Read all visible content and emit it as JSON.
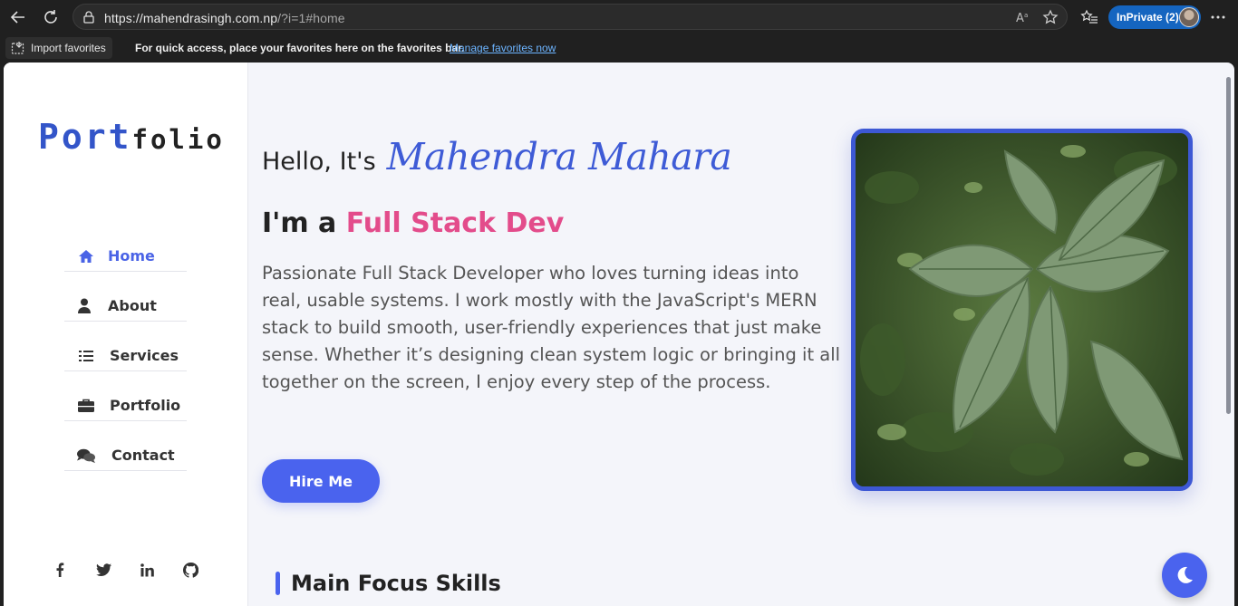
{
  "browser": {
    "url_host": "https://mahendrasingh.com.np",
    "url_path": "/?i=1#home",
    "inprivate_label": "InPrivate (2)",
    "import_favorites": "Import favorites",
    "fav_message": "For quick access, place your favorites here on the favorites bar.",
    "fav_link": "Manage favorites now"
  },
  "sidebar": {
    "logo_a": "Port",
    "logo_b": "folio",
    "items": [
      {
        "label": "Home",
        "icon": "home-icon",
        "active": true
      },
      {
        "label": "About",
        "icon": "user-icon"
      },
      {
        "label": "Services",
        "icon": "list-icon"
      },
      {
        "label": "Portfolio",
        "icon": "briefcase-icon"
      },
      {
        "label": "Contact",
        "icon": "comments-icon"
      }
    ],
    "social": [
      "facebook-icon",
      "twitter-icon",
      "linkedin-icon",
      "github-icon"
    ]
  },
  "hero": {
    "hello": "Hello, It's",
    "name": "Mahendra Mahara",
    "role_prefix": "I'm a",
    "role": "Full Stack Dev",
    "description": "Passionate Full Stack Developer who loves turning ideas into real, usable systems. I work mostly with the JavaScript's MERN stack to build smooth, user-friendly experiences that just make sense. Whether it’s designing clean system logic or bringing it all together on the screen, I enjoy every step of the process.",
    "hire_button": "Hire Me"
  },
  "skills": {
    "heading": "Main Focus Skills"
  },
  "colors": {
    "accent": "#4a63ee",
    "pink": "#e34c8b",
    "name_blue": "#3e5bd6"
  }
}
